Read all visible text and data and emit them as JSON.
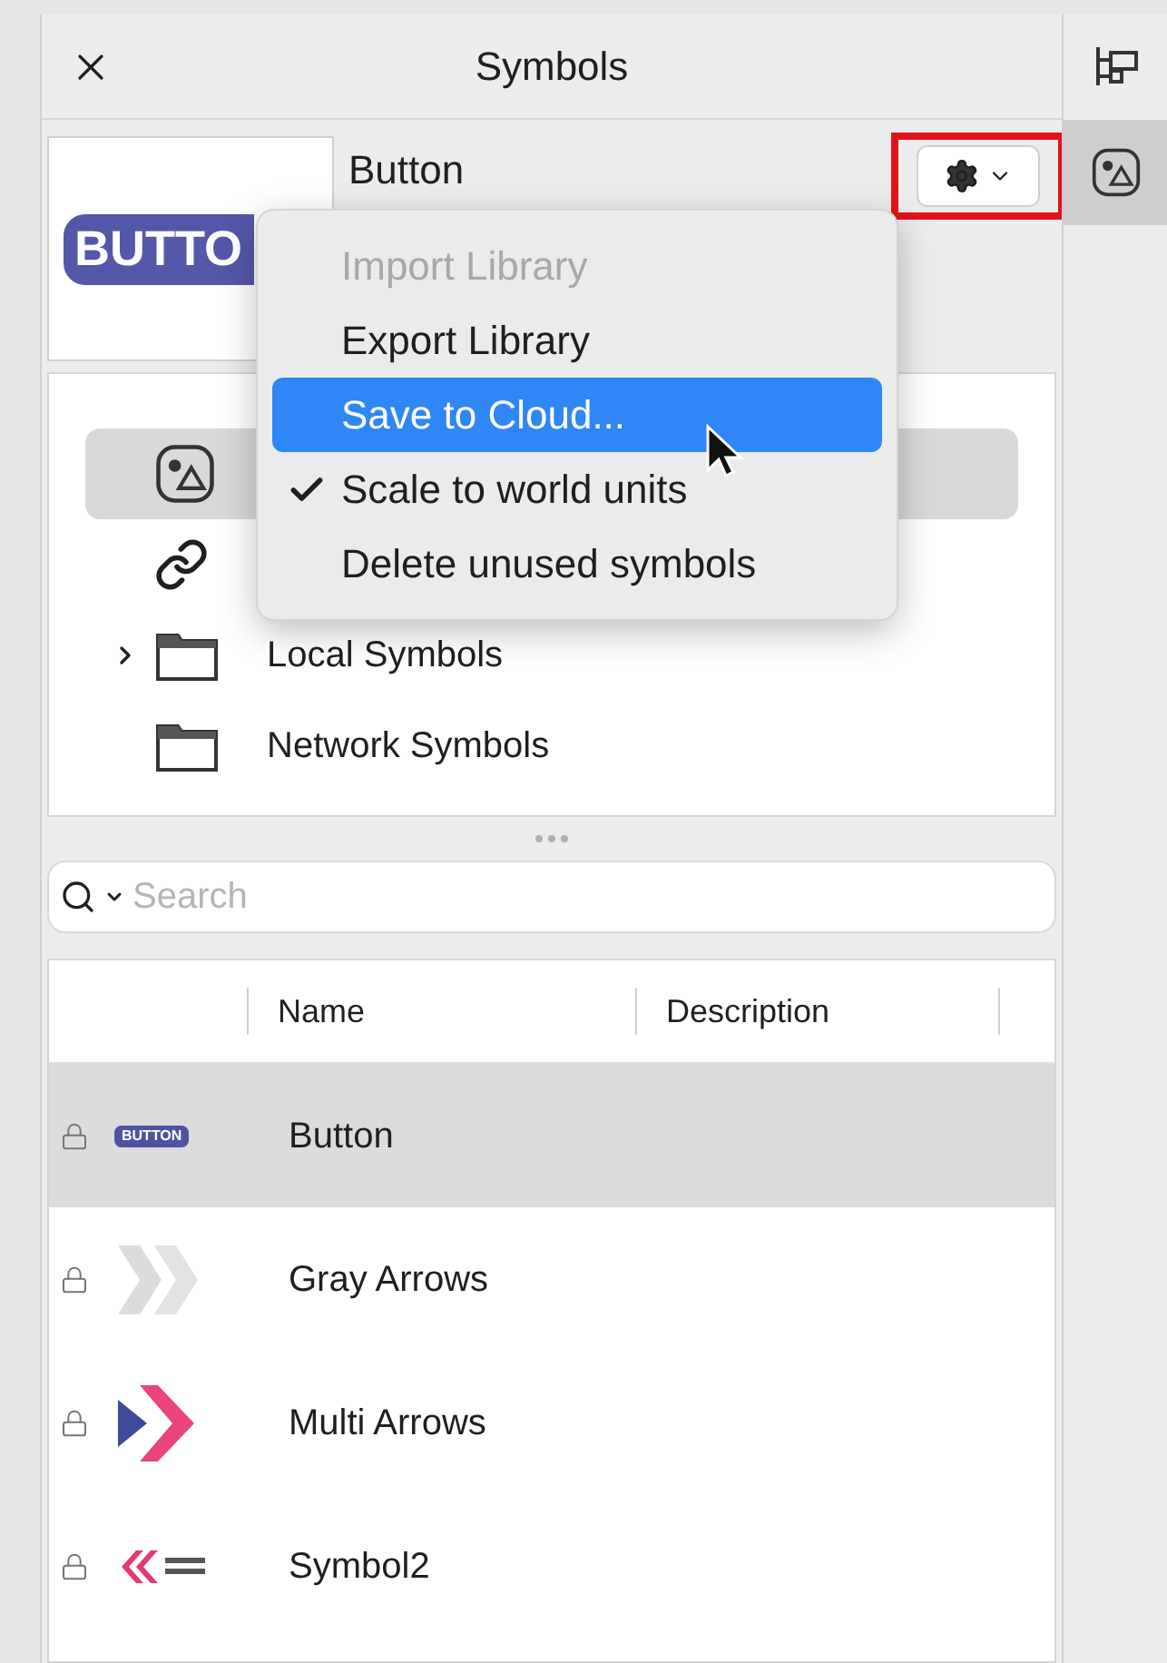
{
  "panel": {
    "title": "Symbols"
  },
  "preview": {
    "thumbnail_text": "BUTTO",
    "name": "Button"
  },
  "gear_button": {
    "highlighted": true
  },
  "menu": {
    "items": [
      {
        "label": "Import Library",
        "disabled": true,
        "selected": false,
        "checked": false
      },
      {
        "label": "Export Library",
        "disabled": false,
        "selected": false,
        "checked": false
      },
      {
        "label": "Save to Cloud...",
        "disabled": false,
        "selected": true,
        "checked": false
      },
      {
        "label": "Scale to world units",
        "disabled": false,
        "selected": false,
        "checked": true
      },
      {
        "label": "Delete unused symbols",
        "disabled": false,
        "selected": false,
        "checked": false
      }
    ]
  },
  "tree": {
    "items": [
      {
        "kind": "symbols",
        "selected": true
      },
      {
        "kind": "link",
        "selected": false
      },
      {
        "kind": "folder",
        "label": "Local Symbols",
        "expandable": true,
        "selected": false
      },
      {
        "kind": "folder",
        "label": "Network Symbols",
        "expandable": false,
        "selected": false
      }
    ]
  },
  "search": {
    "placeholder": "Search"
  },
  "table": {
    "columns": [
      "Name",
      "Description"
    ],
    "rows": [
      {
        "name": "Button",
        "kind": "button",
        "thumbnail_text": "BUTTON",
        "selected": true
      },
      {
        "name": "Gray Arrows",
        "kind": "gray-arrows",
        "selected": false
      },
      {
        "name": "Multi Arrows",
        "kind": "multi-arrows",
        "selected": false
      },
      {
        "name": "Symbol2",
        "kind": "symbol2",
        "selected": false
      }
    ]
  },
  "toolbar": {
    "items": [
      {
        "kind": "hierarchy",
        "selected": false
      },
      {
        "kind": "symbols",
        "selected": true
      }
    ]
  }
}
